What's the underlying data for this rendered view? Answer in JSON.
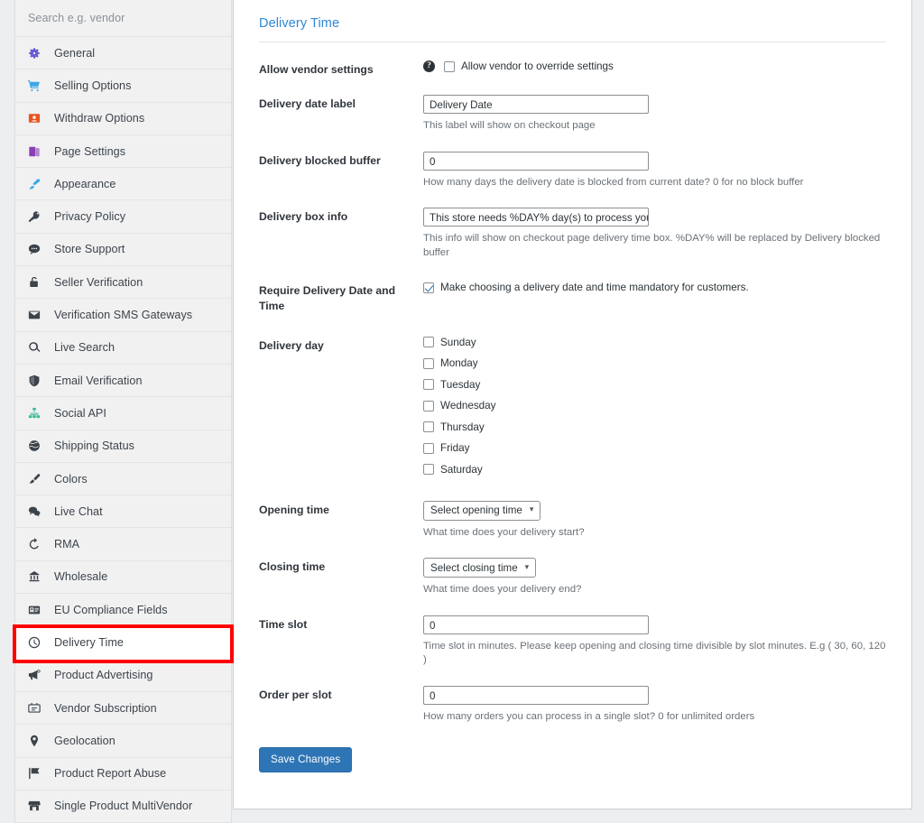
{
  "sidebar": {
    "search": {
      "placeholder": "Search e.g. vendor"
    },
    "items": [
      {
        "label": "General",
        "icon": "gear-icon",
        "color": "#6b5bd6",
        "active": false
      },
      {
        "label": "Selling Options",
        "icon": "cart-icon",
        "color": "#3ca7e8",
        "active": false
      },
      {
        "label": "Withdraw Options",
        "icon": "withdraw-icon",
        "color": "#e8541f",
        "active": false
      },
      {
        "label": "Page Settings",
        "icon": "pages-icon",
        "color": "#8b3fb5",
        "active": false
      },
      {
        "label": "Appearance",
        "icon": "brush-icon",
        "color": "#3ca7e8",
        "active": false
      },
      {
        "label": "Privacy Policy",
        "icon": "key-icon",
        "color": "#3c434a",
        "active": false
      },
      {
        "label": "Store Support",
        "icon": "chat-bubble-icon",
        "color": "#3c434a",
        "active": false
      },
      {
        "label": "Seller Verification",
        "icon": "lock-icon",
        "color": "#3c434a",
        "active": false
      },
      {
        "label": "Verification SMS Gateways",
        "icon": "envelope-icon",
        "color": "#3c434a",
        "active": false
      },
      {
        "label": "Live Search",
        "icon": "search-icon",
        "color": "#3c434a",
        "active": false
      },
      {
        "label": "Email Verification",
        "icon": "shield-icon",
        "color": "#3c434a",
        "active": false
      },
      {
        "label": "Social API",
        "icon": "sitemap-icon",
        "color": "#34bb91",
        "active": false
      },
      {
        "label": "Shipping Status",
        "icon": "globe-icon",
        "color": "#3c434a",
        "active": false
      },
      {
        "label": "Colors",
        "icon": "paintbrush-icon",
        "color": "#3c434a",
        "active": false
      },
      {
        "label": "Live Chat",
        "icon": "chat-icon",
        "color": "#3c434a",
        "active": false
      },
      {
        "label": "RMA",
        "icon": "undo-icon",
        "color": "#3c434a",
        "active": false
      },
      {
        "label": "Wholesale",
        "icon": "network-icon",
        "color": "#3c434a",
        "active": false
      },
      {
        "label": "EU Compliance Fields",
        "icon": "id-card-icon",
        "color": "#3c434a",
        "active": false
      },
      {
        "label": "Delivery Time",
        "icon": "clock-icon",
        "color": "#3c434a",
        "active": true
      },
      {
        "label": "Product Advertising",
        "icon": "megaphone-icon",
        "color": "#3c434a",
        "active": false
      },
      {
        "label": "Vendor Subscription",
        "icon": "subscription-icon",
        "color": "#3c434a",
        "active": false
      },
      {
        "label": "Geolocation",
        "icon": "map-pin-icon",
        "color": "#3c434a",
        "active": false
      },
      {
        "label": "Product Report Abuse",
        "icon": "flag-icon",
        "color": "#3c434a",
        "active": false
      },
      {
        "label": "Single Product MultiVendor",
        "icon": "store-icon",
        "color": "#3c434a",
        "active": false
      }
    ]
  },
  "panel": {
    "title": "Delivery Time",
    "accent_color": "#2e87d6",
    "fields": {
      "allow_vendor": {
        "label": "Allow vendor settings",
        "help_icon": "question-mark-icon",
        "checkbox_label": "Allow vendor to override settings",
        "checked": false
      },
      "delivery_date_label": {
        "label": "Delivery date label",
        "value": "Delivery Date",
        "helper": "This label will show on checkout page"
      },
      "delivery_blocked_buffer": {
        "label": "Delivery blocked buffer",
        "value": "0",
        "helper": "How many days the delivery date is blocked from current date? 0 for no block buffer"
      },
      "delivery_box_info": {
        "label": "Delivery box info",
        "value": "This store needs %DAY% day(s) to process your de",
        "helper": "This info will show on checkout page delivery time box. %DAY% will be replaced by Delivery blocked buffer"
      },
      "require_delivery": {
        "label": "Require Delivery Date and Time",
        "checkbox_label": "Make choosing a delivery date and time mandatory for customers.",
        "checked": true
      },
      "delivery_day": {
        "label": "Delivery day",
        "days": [
          {
            "label": "Sunday",
            "checked": false
          },
          {
            "label": "Monday",
            "checked": false
          },
          {
            "label": "Tuesday",
            "checked": false
          },
          {
            "label": "Wednesday",
            "checked": false
          },
          {
            "label": "Thursday",
            "checked": false
          },
          {
            "label": "Friday",
            "checked": false
          },
          {
            "label": "Saturday",
            "checked": false
          }
        ]
      },
      "opening_time": {
        "label": "Opening time",
        "selected": "Select opening time",
        "helper": "What time does your delivery start?"
      },
      "closing_time": {
        "label": "Closing time",
        "selected": "Select closing time",
        "helper": "What time does your delivery end?"
      },
      "time_slot": {
        "label": "Time slot",
        "value": "0",
        "helper": "Time slot in minutes. Please keep opening and closing time divisible by slot minutes. E.g ( 30, 60, 120 )"
      },
      "order_per_slot": {
        "label": "Order per slot",
        "value": "0",
        "helper": "How many orders you can process in a single slot? 0 for unlimited orders"
      }
    },
    "save_button": {
      "label": "Save Changes",
      "color": "#2e75b6"
    }
  },
  "highlight": {
    "color": "#ff0000",
    "target": "Delivery Time"
  }
}
